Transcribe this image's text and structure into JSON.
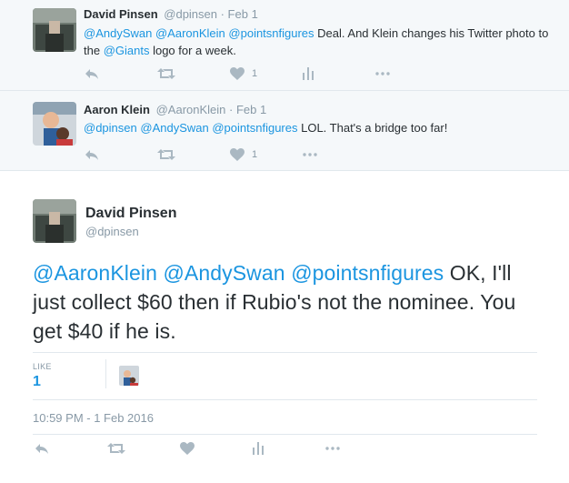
{
  "tweets": [
    {
      "fullname": "David Pinsen",
      "meta": "@dpinsen · Feb 1",
      "text_parts": [
        {
          "type": "mention",
          "text": "@AndySwan"
        },
        {
          "type": "text",
          "text": " "
        },
        {
          "type": "mention",
          "text": "@AaronKlein"
        },
        {
          "type": "text",
          "text": " "
        },
        {
          "type": "mention",
          "text": "@pointsnfigures"
        },
        {
          "type": "text",
          "text": " Deal. And Klein changes his Twitter photo to the "
        },
        {
          "type": "mention",
          "text": "@Giants"
        },
        {
          "type": "text",
          "text": " logo for a week."
        }
      ],
      "like_count": "1",
      "icons": [
        "reply-icon",
        "retweet-icon",
        "heart-icon",
        "analytics-icon",
        "more-icon"
      ]
    },
    {
      "fullname": "Aaron Klein",
      "meta": "@AaronKlein · Feb 1",
      "text_parts": [
        {
          "type": "mention",
          "text": "@dpinsen"
        },
        {
          "type": "text",
          "text": " "
        },
        {
          "type": "mention",
          "text": "@AndySwan"
        },
        {
          "type": "text",
          "text": " "
        },
        {
          "type": "mention",
          "text": "@pointsnfigures"
        },
        {
          "type": "text",
          "text": " LOL. That's a bridge too far!"
        }
      ],
      "like_count": "1",
      "icons": [
        "reply-icon",
        "retweet-icon",
        "heart-icon",
        "more-icon"
      ]
    }
  ],
  "main": {
    "fullname": "David Pinsen",
    "handle": "@dpinsen",
    "text_parts": [
      {
        "type": "mention",
        "text": "@AaronKlein"
      },
      {
        "type": "text",
        "text": " "
      },
      {
        "type": "mention",
        "text": "@AndySwan"
      },
      {
        "type": "text",
        "text": " "
      },
      {
        "type": "mention",
        "text": "@pointsnfigures"
      },
      {
        "type": "text",
        "text": " OK, I'll just collect $60 then if Rubio's not the nominee. You get $40 if he is."
      }
    ],
    "likes_label": "LIKE",
    "likes_count": "1",
    "timestamp": "10:59 PM - 1 Feb 2016",
    "icons": [
      "reply-icon",
      "retweet-icon",
      "heart-icon",
      "analytics-icon",
      "more-icon"
    ]
  },
  "colors": {
    "mention": "#1b95e0",
    "icon": "#aab8c2",
    "secondary_text": "#8899a6",
    "background_context": "#f5f8fa"
  }
}
